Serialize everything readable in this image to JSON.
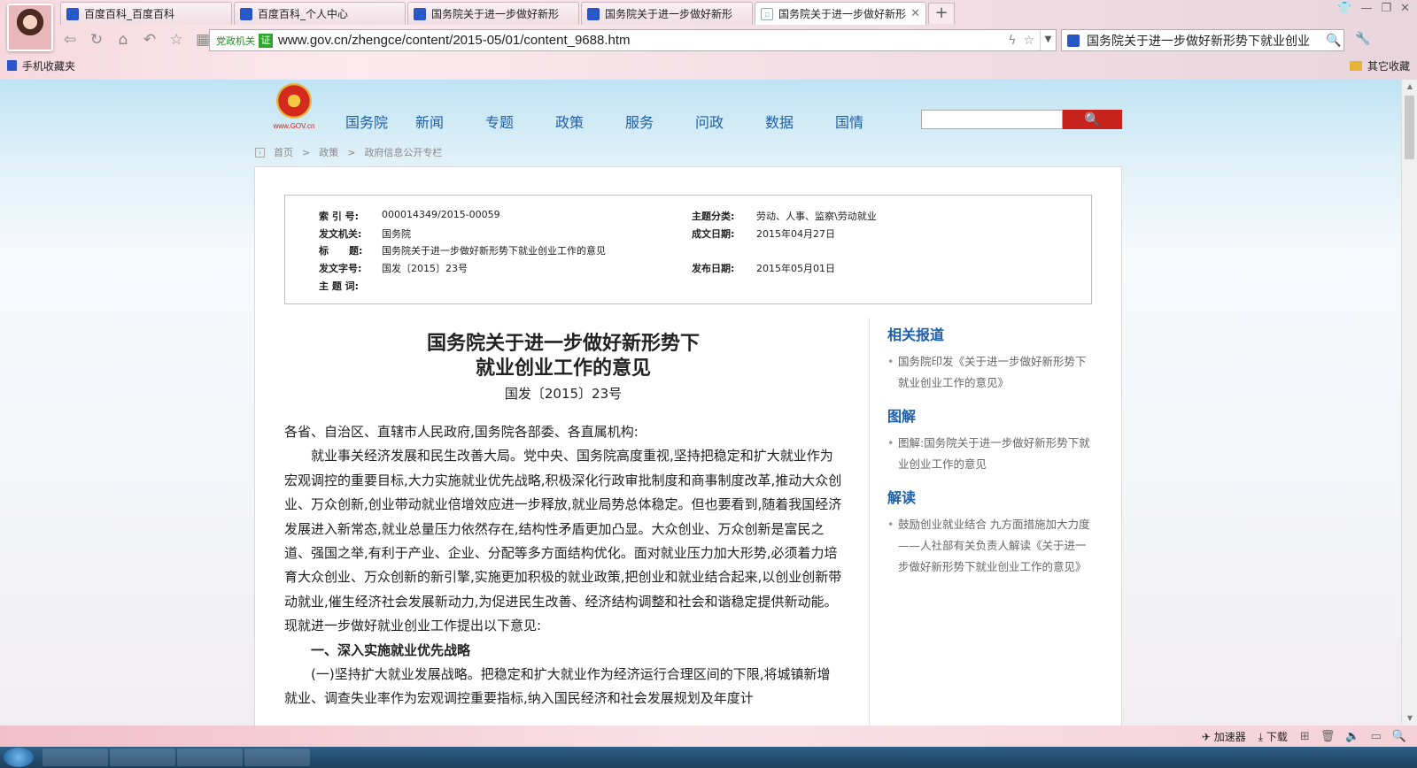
{
  "browser": {
    "tabs": [
      {
        "label": "百度百科_百度百科",
        "icon": "baidu-paw-icon",
        "active": false
      },
      {
        "label": "百度百科_个人中心",
        "icon": "baidu-paw-icon",
        "active": false
      },
      {
        "label": "国务院关于进一步做好新形",
        "icon": "baidu-paw-icon",
        "active": false
      },
      {
        "label": "国务院关于进一步做好新形",
        "icon": "baidu-paw-icon",
        "active": false
      },
      {
        "label": "国务院关于进一步做好新形",
        "icon": "document-icon",
        "active": true
      }
    ],
    "newtab_label": "+",
    "url_badge": "党政机关",
    "url_verify": "证",
    "url": "www.gov.cn/zhengce/content/2015-05/01/content_9688.htm",
    "search_text": "国务院关于进一步做好新形势下就业创业",
    "bookmarks_left": "手机收藏夹",
    "bookmarks_right": "其它收藏"
  },
  "site": {
    "logo_text": "www.GOV.cn",
    "nav": [
      "国务院",
      "新闻",
      "专题",
      "政策",
      "服务",
      "问政",
      "数据",
      "国情"
    ],
    "breadcrumb": [
      "首页",
      "政策",
      "政府信息公开专栏"
    ],
    "breadcrumb_sep": ">"
  },
  "meta": {
    "index_label": "索 引 号:",
    "index_value": "000014349/2015-00059",
    "category_label": "主题分类:",
    "category_value": "劳动、人事、监察\\劳动就业",
    "issuer_label": "发文机关:",
    "issuer_value": "国务院",
    "date_written_label": "成文日期:",
    "date_written_value": "2015年04月27日",
    "title_label": "标      题:",
    "title_value": "国务院关于进一步做好新形势下就业创业工作的意见",
    "docno_label": "发文字号:",
    "docno_value": "国发〔2015〕23号",
    "publish_label": "发布日期:",
    "publish_value": "2015年05月01日",
    "keywords_label": "主 题 词:",
    "keywords_value": ""
  },
  "article": {
    "title_line1": "国务院关于进一步做好新形势下",
    "title_line2": "就业创业工作的意见",
    "doc_number": "国发〔2015〕23号",
    "salutation": "各省、自治区、直辖市人民政府,国务院各部委、各直属机构:",
    "para1": "就业事关经济发展和民生改善大局。党中央、国务院高度重视,坚持把稳定和扩大就业作为宏观调控的重要目标,大力实施就业优先战略,积极深化行政审批制度和商事制度改革,推动大众创业、万众创新,创业带动就业倍增效应进一步释放,就业局势总体稳定。但也要看到,随着我国经济发展进入新常态,就业总量压力依然存在,结构性矛盾更加凸显。大众创业、万众创新是富民之道、强国之举,有利于产业、企业、分配等多方面结构优化。面对就业压力加大形势,必须着力培育大众创业、万众创新的新引擎,实施更加积极的就业政策,把创业和就业结合起来,以创业创新带动就业,催生经济社会发展新动力,为促进民生改善、经济结构调整和社会和谐稳定提供新动能。现就进一步做好就业创业工作提出以下意见:",
    "section1": "一、深入实施就业优先战略",
    "para2": "(一)坚持扩大就业发展战略。把稳定和扩大就业作为经济运行合理区间的下限,将城镇新增就业、调查失业率作为宏观调控重要指标,纳入国民经济和社会发展规划及年度计"
  },
  "sidebar": {
    "sections": [
      {
        "heading": "相关报道",
        "items": [
          "国务院印发《关于进一步做好新形势下就业创业工作的意见》"
        ]
      },
      {
        "heading": "图解",
        "items": [
          "图解:国务院关于进一步做好新形势下就业创业工作的意见"
        ]
      },
      {
        "heading": "解读",
        "items": [
          "鼓励创业就业结合 九方面措施加大力度——人社部有关负责人解读《关于进一步做好新形势下就业创业工作的意见》"
        ]
      }
    ]
  },
  "statusbar": {
    "accelerator": "加速器",
    "download": "下载"
  },
  "colors": {
    "link_blue": "#1f5fa8",
    "brand_red": "#c7231c"
  }
}
